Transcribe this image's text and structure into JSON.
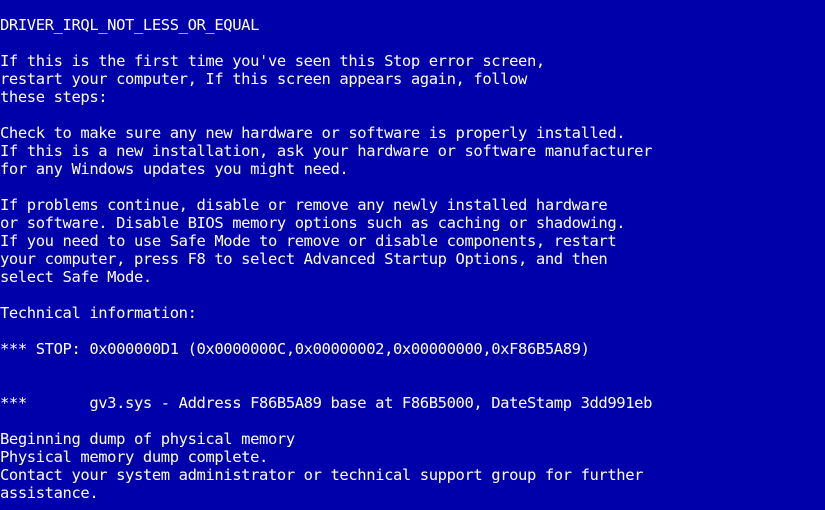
{
  "colors": {
    "background": "#0000aa",
    "text": "#ffffff"
  },
  "screen": {
    "error_code": "DRIVER_IRQL_NOT_LESS_OR_EQUAL",
    "intro": [
      "If this is the first time you've seen this Stop error screen,",
      "restart your computer, If this screen appears again, follow",
      "these steps:"
    ],
    "check": [
      "Check to make sure any new hardware or software is properly installed.",
      "If this is a new installation, ask your hardware or software manufacturer",
      "for any Windows updates you might need."
    ],
    "problems": [
      "If problems continue, disable or remove any newly installed hardware",
      "or software. Disable BIOS memory options such as caching or shadowing.",
      "If you need to use Safe Mode to remove or disable components, restart",
      "your computer, press F8 to select Advanced Startup Options, and then",
      "select Safe Mode."
    ],
    "technical_heading": "Technical information:",
    "stop_line": "*** STOP: 0x000000D1 (0x0000000C,0x00000002,0x00000000,0xF86B5A89)",
    "driver_line": "***       gv3.sys - Address F86B5A89 base at F86B5000, DateStamp 3dd991eb",
    "dump": [
      "Beginning dump of physical memory",
      "Physical memory dump complete.",
      "Contact your system administrator or technical support group for further",
      "assistance."
    ]
  }
}
